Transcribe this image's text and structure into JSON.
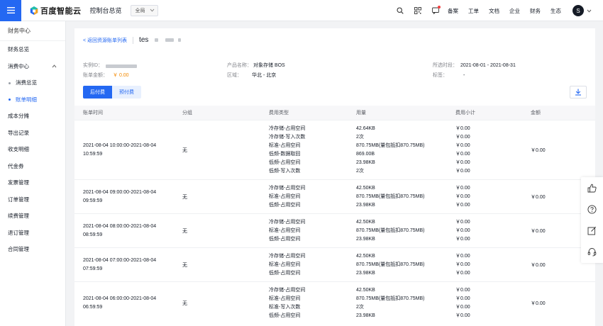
{
  "topbar": {
    "brand": "百度智能云",
    "console_title": "控制台总览",
    "region": "全局",
    "links": [
      "备案",
      "工单",
      "文档",
      "企业",
      "财务",
      "生态"
    ],
    "avatar_letter": "S"
  },
  "sidebar": {
    "header": "财务中心",
    "items": [
      {
        "label": "财务总览"
      },
      {
        "label": "消费中心"
      },
      {
        "label": "消费总览"
      },
      {
        "label": "账单明细"
      },
      {
        "label": "成本分摊"
      },
      {
        "label": "导出记录"
      },
      {
        "label": "收支明细"
      },
      {
        "label": "代金券"
      },
      {
        "label": "发票管理"
      },
      {
        "label": "订单管理"
      },
      {
        "label": "续费管理"
      },
      {
        "label": "退订管理"
      },
      {
        "label": "合同管理"
      }
    ]
  },
  "detail": {
    "back_link": "< 返回资源账单列表",
    "title_prefix": "tes",
    "instance_label": "实例ID：",
    "amount_label": "账单金额：",
    "amount_value": "￥ 0.00",
    "product_label": "产品名称：",
    "product_value": "对象存储 BOS",
    "region_label": "区域：",
    "region_value": "华北 - 北京",
    "period_label": "所选时段：",
    "period_value": "2021-08-01 - 2021-08-31",
    "tag_label": "标签：",
    "tag_value": "-",
    "tab_postpaid": "后付费",
    "tab_prepaid": "预付费"
  },
  "table": {
    "headers": [
      "账单时间",
      "分组",
      "费用类型",
      "用量",
      "费用小计",
      "金额"
    ],
    "rows": [
      {
        "time": [
          "2021-08-04 10:00:00-2021-08-04",
          "10:59:59"
        ],
        "group": "无",
        "types": [
          "冷存储-占用空间",
          "冷存储-写入次数",
          "标准-占用空间",
          "低频-数据取回",
          "低频-占用空间",
          "低频-写入次数"
        ],
        "usages": [
          "42.64KB",
          "2次",
          "870.75MB(量包抵扣870.75MB)",
          "869.00B",
          "23.98KB",
          "2次"
        ],
        "subtotals": [
          "￥0.00",
          "￥0.00",
          "￥0.00",
          "￥0.00",
          "￥0.00",
          "￥0.00"
        ],
        "amount": "￥0.00"
      },
      {
        "time": [
          "2021-08-04 09:00:00-2021-08-04",
          "09:59:59"
        ],
        "group": "无",
        "types": [
          "冷存储-占用空间",
          "标准-占用空间",
          "低频-占用空间"
        ],
        "usages": [
          "42.50KB",
          "870.75MB(量包抵扣870.75MB)",
          "23.98KB"
        ],
        "subtotals": [
          "￥0.00",
          "￥0.00",
          "￥0.00"
        ],
        "amount": "￥0.00"
      },
      {
        "time": [
          "2021-08-04 08:00:00-2021-08-04",
          "08:59:59"
        ],
        "group": "无",
        "types": [
          "冷存储-占用空间",
          "标准-占用空间",
          "低频-占用空间"
        ],
        "usages": [
          "42.50KB",
          "870.75MB(量包抵扣870.75MB)",
          "23.98KB"
        ],
        "subtotals": [
          "￥0.00",
          "￥0.00",
          "￥0.00"
        ],
        "amount": "￥0.00"
      },
      {
        "time": [
          "2021-08-04 07:00:00-2021-08-04",
          "07:59:59"
        ],
        "group": "无",
        "types": [
          "冷存储-占用空间",
          "标准-占用空间",
          "低频-占用空间"
        ],
        "usages": [
          "42.50KB",
          "870.75MB(量包抵扣870.75MB)",
          "23.98KB"
        ],
        "subtotals": [
          "￥0.00",
          "￥0.00",
          "￥0.00"
        ],
        "amount": "￥0.00"
      },
      {
        "time": [
          "2021-08-04 06:00:00-2021-08-04",
          "06:59:59"
        ],
        "group": "无",
        "types": [
          "冷存储-占用空间",
          "标准-占用空间",
          "标准-写入次数",
          "低频-占用空间"
        ],
        "usages": [
          "42.50KB",
          "870.75MB(量包抵扣870.75MB)",
          "2次",
          "23.98KB"
        ],
        "subtotals": [
          "￥0.00",
          "￥0.00",
          "￥0.00",
          "￥0.00"
        ],
        "amount": "￥0.00"
      }
    ]
  },
  "float_tools": [
    "thumbs-up-icon",
    "help-icon",
    "edit-icon",
    "headset-icon"
  ]
}
